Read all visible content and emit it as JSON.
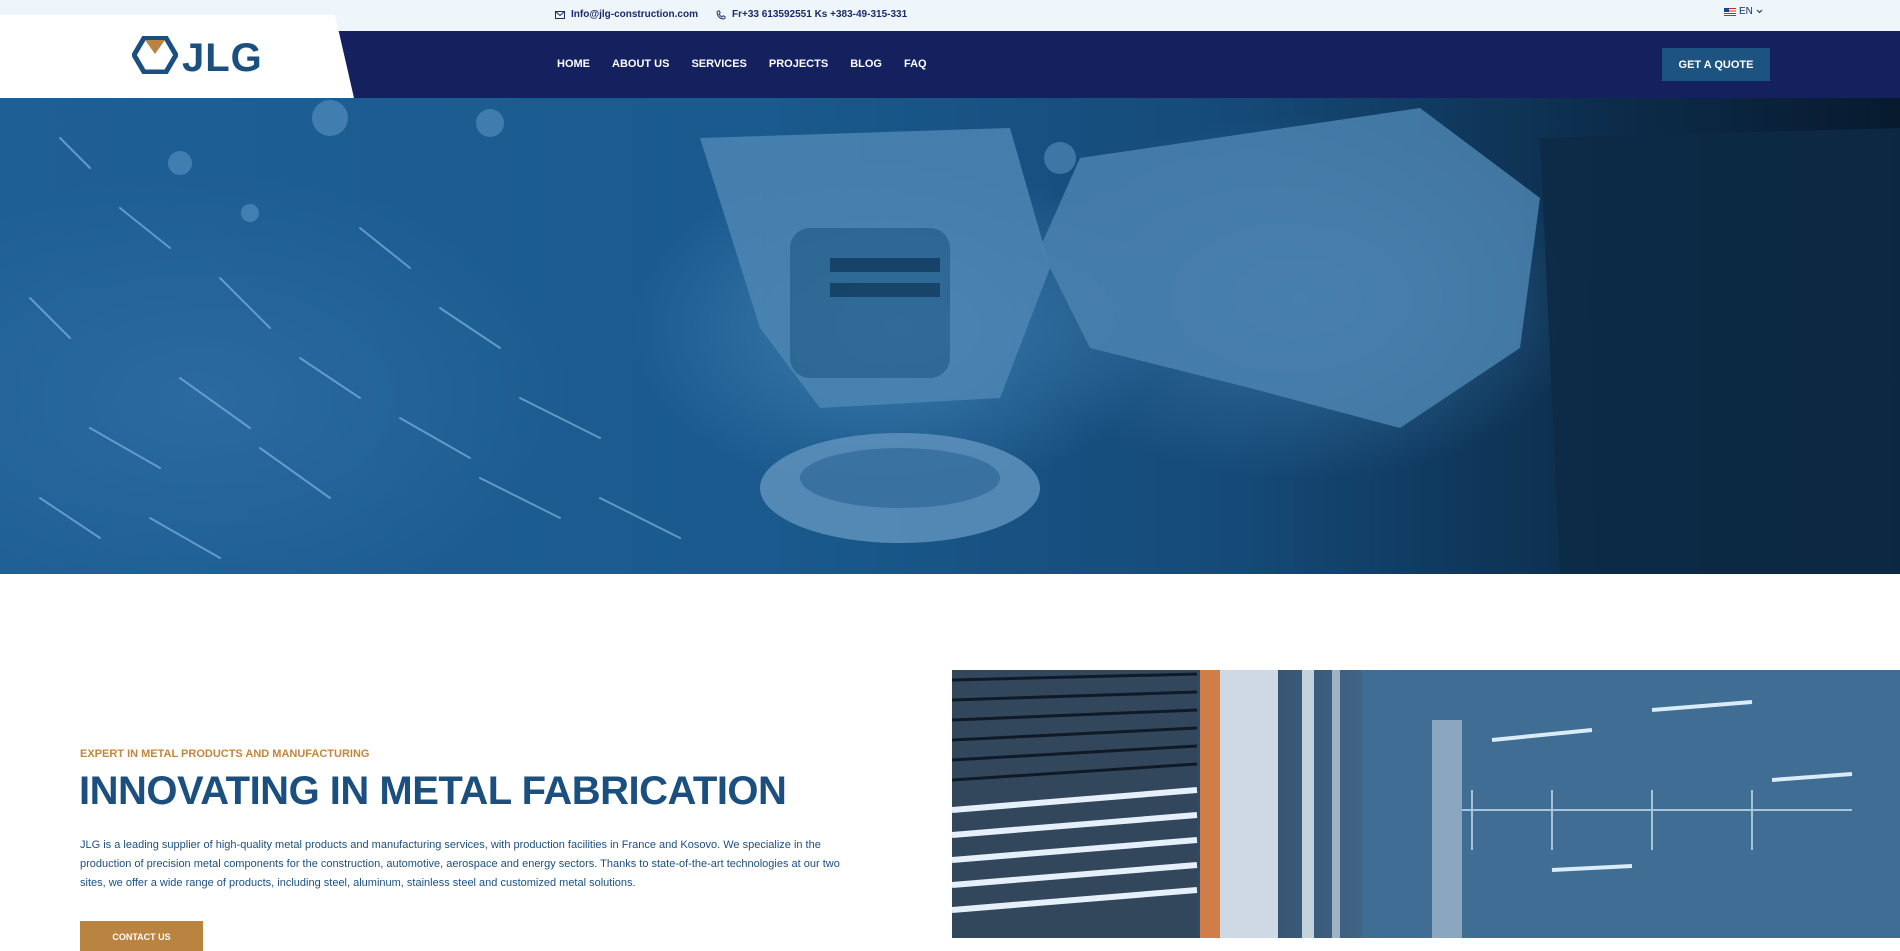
{
  "topbar": {
    "email": "Info@jlg-construction.com",
    "phone": "Fr+33 613592551 Ks +383-49-315-331",
    "language": "EN"
  },
  "brand": {
    "logo_text": "JLG",
    "accent_color": "#b8843f",
    "primary_color": "#1b4f7f",
    "nav_bg_color": "#14215e"
  },
  "nav": {
    "items": [
      "HOME",
      "ABOUT US",
      "SERVICES",
      "PROJECTS",
      "BLOG",
      "FAQ"
    ],
    "cta_label": "GET A QUOTE"
  },
  "intro": {
    "eyebrow": "EXPERT IN METAL PRODUCTS AND MANUFACTURING",
    "headline": "INNOVATING IN METAL FABRICATION",
    "body": "JLG is a leading supplier of high-quality metal products and manufacturing services, with production facilities in France and Kosovo. We specialize in the production of precision metal components for the construction, automotive, aerospace and energy sectors. Thanks to state-of-the-art technologies at our two sites, we offer a wide range of products, including steel, aluminum, stainless steel and customized metal solutions.",
    "button_label": "CONTACT US"
  },
  "icons": {
    "email": "envelope-icon",
    "phone": "phone-icon",
    "flag": "us-flag-icon",
    "dropdown": "chevron-down-icon"
  }
}
